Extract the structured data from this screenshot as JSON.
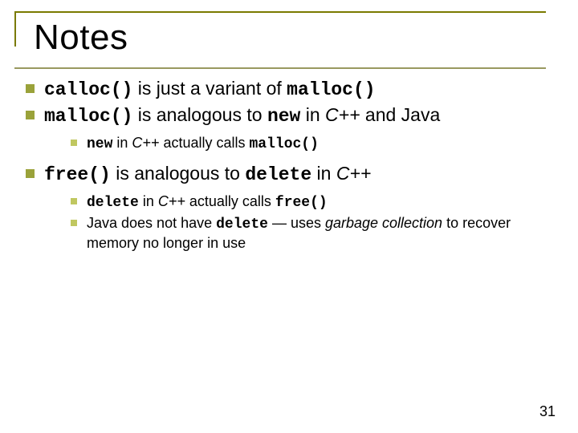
{
  "title": "Notes",
  "bullets": {
    "b1": {
      "c1": "calloc()",
      "t1": " is just a variant of ",
      "c2": "malloc()"
    },
    "b2": {
      "c1": "malloc()",
      "t1": " is analogous to ",
      "c2": "new",
      "t2": " in ",
      "i1": "C++",
      "t3": " and Java"
    },
    "b2s1": {
      "c1": "new",
      "t1": " in ",
      "i1": "C++",
      "t2": " actually calls ",
      "c2": "malloc()"
    },
    "b3": {
      "c1": "free()",
      "t1": " is analogous to ",
      "c2": "delete",
      "t2": " in ",
      "i1": "C++"
    },
    "b3s1": {
      "c1": "delete",
      "t1": " in ",
      "i1": "C++",
      "t2": " actually calls ",
      "c2": "free()"
    },
    "b3s2": {
      "t1": "Java does not have ",
      "c1": "delete",
      "t2": " — uses ",
      "i1": "garbage collection",
      "t3": " to recover memory no longer in use"
    }
  },
  "pagenum": "31"
}
